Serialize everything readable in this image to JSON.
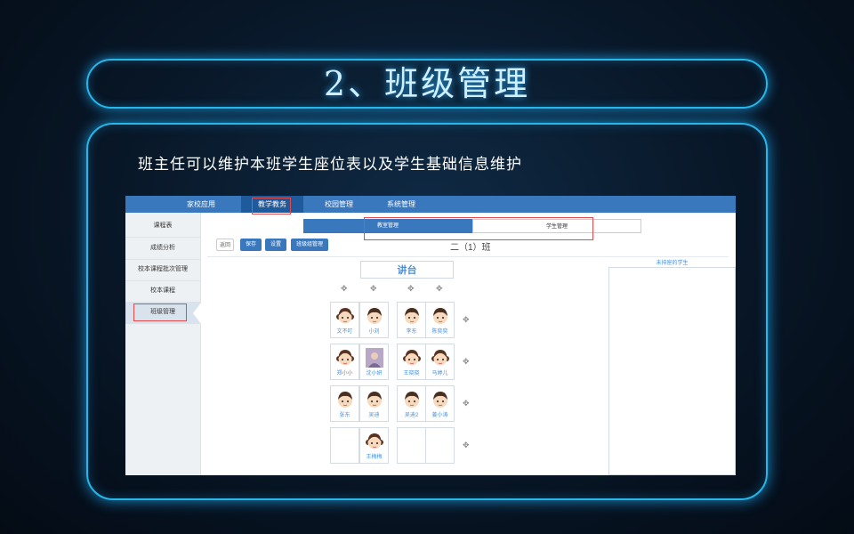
{
  "slide": {
    "title": "2、班级管理",
    "subtitle": "班主任可以维护本班学生座位表以及学生基础信息维护"
  },
  "topnav": {
    "items": [
      {
        "label": "家校应用"
      },
      {
        "label": "教学教务"
      },
      {
        "label": "校园管理"
      },
      {
        "label": "系统管理"
      }
    ]
  },
  "sidebar": {
    "items": [
      {
        "label": "课程表"
      },
      {
        "label": "成绩分析"
      },
      {
        "label": "校本课程批次管理"
      },
      {
        "label": "校本课程"
      },
      {
        "label": "班级管理"
      }
    ]
  },
  "tabs": [
    {
      "label": "教室管理"
    },
    {
      "label": "学生管理"
    }
  ],
  "toolbar": {
    "back": "返回",
    "save": "保存",
    "settings": "设置",
    "class_admin": "班级组管理"
  },
  "class_name": "二（1）班",
  "podium": "讲台",
  "unassigned_label": "未排座的学生",
  "seats": [
    {
      "name": "文不叮",
      "face": "girl"
    },
    {
      "name": "小刘",
      "face": "boy"
    },
    {
      "name": "李东",
      "face": "boy"
    },
    {
      "name": "陈奕奕",
      "face": "boy"
    },
    {
      "name": "郑小小",
      "face": "girl"
    },
    {
      "name": "沈小妍",
      "face": "photo"
    },
    {
      "name": "王晓晓",
      "face": "girl"
    },
    {
      "name": "马婷儿",
      "face": "girl"
    },
    {
      "name": "张东",
      "face": "boy"
    },
    {
      "name": "吴迪",
      "face": "boy"
    },
    {
      "name": "吴迪2",
      "face": "boy"
    },
    {
      "name": "姜小涛",
      "face": "boy"
    },
    {
      "name": "",
      "face": "none"
    },
    {
      "name": "王梅梅",
      "face": "girl"
    },
    {
      "name": "",
      "face": "none"
    },
    {
      "name": "",
      "face": "none"
    }
  ],
  "icons": {
    "move": "move-icon",
    "girl": "girl-avatar-icon",
    "boy": "boy-avatar-icon"
  },
  "colors": {
    "accent": "#27b8e8",
    "nav": "#3a78bd",
    "highlight": "#e24b4b"
  }
}
